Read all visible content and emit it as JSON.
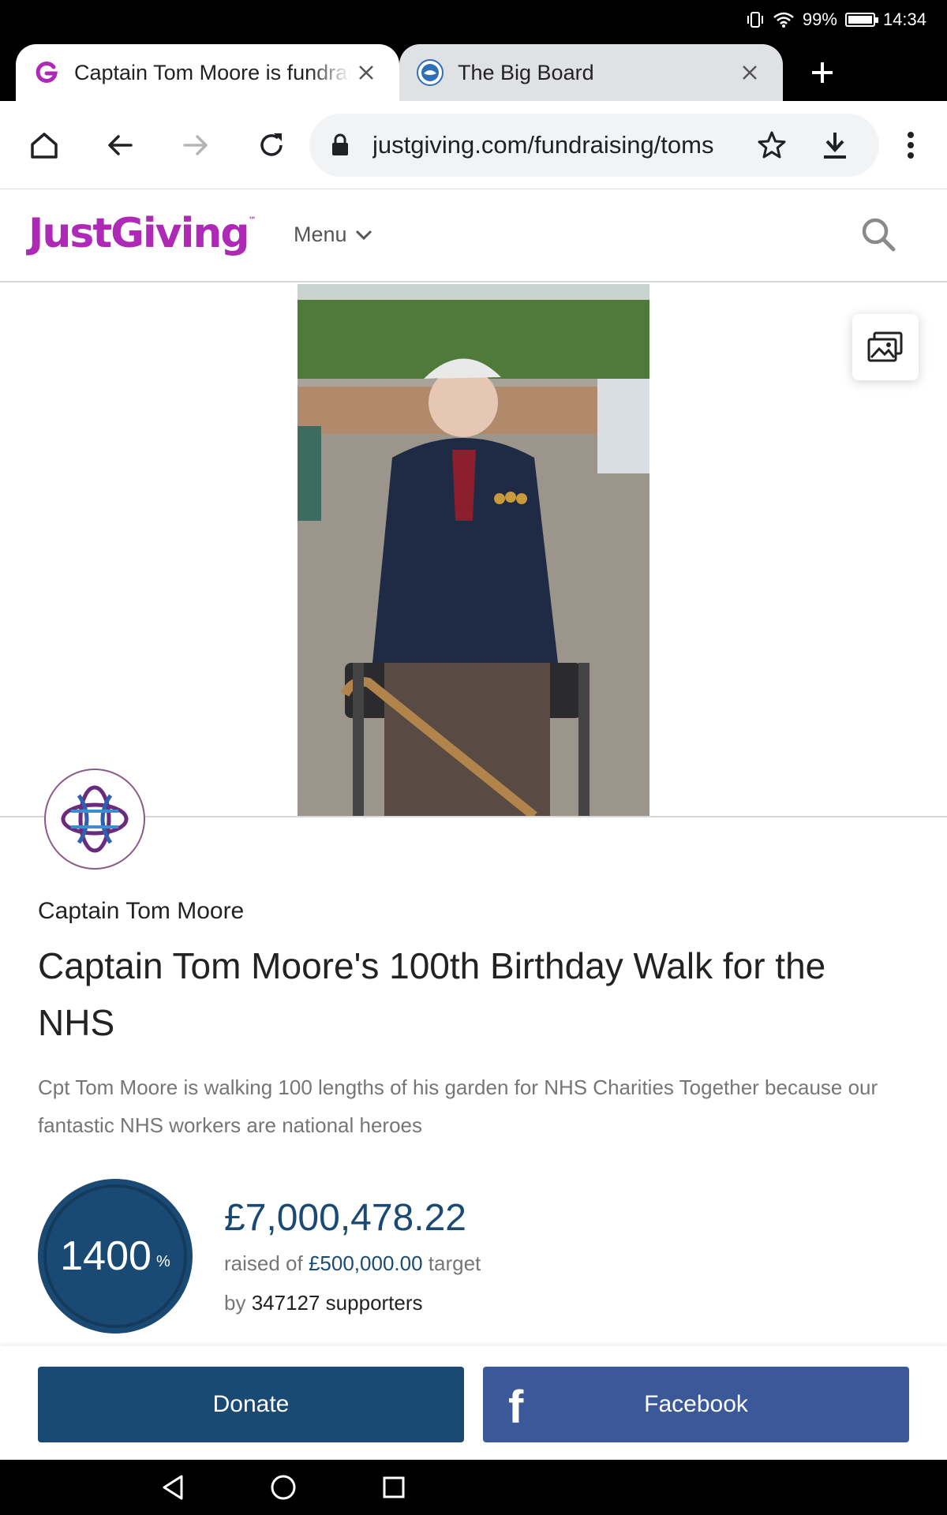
{
  "status_bar": {
    "battery": "99%",
    "time": "14:34"
  },
  "tabs": [
    {
      "title": "Captain Tom Moore is fundraising for NHS Charities Together",
      "favicon": "justgiving-g-icon",
      "active": true
    },
    {
      "title": "The Big Board",
      "favicon": "brighton-club-icon",
      "active": false
    }
  ],
  "toolbar": {
    "url": "justgiving.com/fundraising/toms"
  },
  "site": {
    "logo": "JustGiving",
    "logo_tm": "™",
    "menu_label": "Menu"
  },
  "page": {
    "fundraiser_name": "Captain Tom Moore",
    "title": "Captain Tom Moore's 100th Birthday Walk for the NHS",
    "description": "Cpt Tom Moore is walking 100 lengths of his garden for NHS Charities Together because our fantastic NHS workers are national heroes",
    "progress_percent": "1400",
    "progress_percent_sign": "%",
    "raised_amount": "£7,000,478.22",
    "raised_prefix": "raised of",
    "target_amount": "£500,000.00",
    "target_suffix": "target",
    "supporters_prefix": "by",
    "supporters_count": "347127 supporters"
  },
  "actions": {
    "donate_label": "Donate",
    "facebook_label": "Facebook",
    "facebook_icon_glyph": "f"
  },
  "colors": {
    "brand_purple": "#ad29b6",
    "primary_navy": "#1a4a73",
    "facebook_blue": "#3b5998"
  }
}
